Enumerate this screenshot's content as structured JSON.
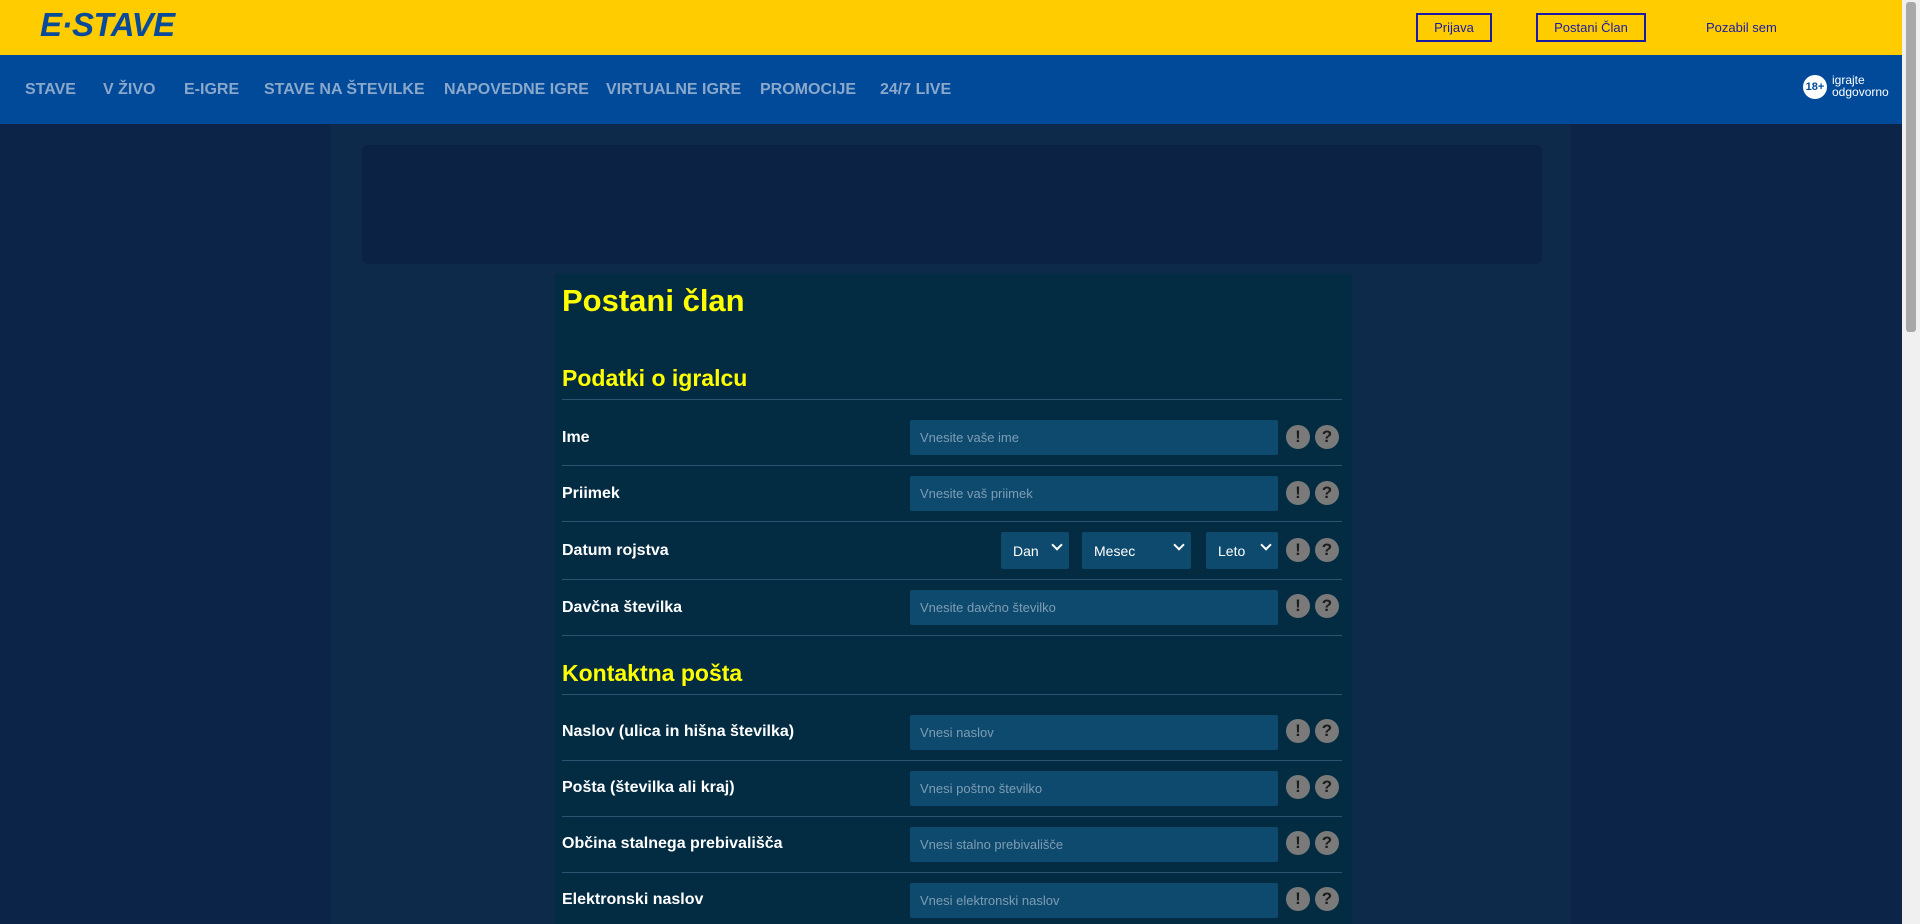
{
  "header": {
    "logo": "E·STAVE",
    "login_label": "Prijava",
    "register_label": "Postani Član",
    "forgot_label": "Pozabil sem"
  },
  "nav": {
    "items": [
      "STAVE",
      "V ŽIVO",
      "E-IGRE",
      "STAVE NA ŠTEVILKE",
      "NAPOVEDNE IGRE",
      "VIRTUALNE IGRE",
      "PROMOCIJE",
      "24/7 LIVE"
    ],
    "age_badge": "18+",
    "responsible_line1": "igrajte",
    "responsible_line2": "odgovorno"
  },
  "page": {
    "title": "Postani član"
  },
  "section_player": {
    "heading": "Podatki o igralcu",
    "first_name_label": "Ime",
    "first_name_placeholder": "Vnesite vaše ime",
    "last_name_label": "Priimek",
    "last_name_placeholder": "Vnesite vaš priimek",
    "birth_label": "Datum rojstva",
    "day_selected": "Dan",
    "month_selected": "Mesec",
    "year_selected": "Leto",
    "tax_label": "Davčna številka",
    "tax_placeholder": "Vnesite davčno številko"
  },
  "section_contact": {
    "heading": "Kontaktna pošta",
    "address_label": "Naslov (ulica in hišna številka)",
    "address_placeholder": "Vnesi naslov",
    "post_label": "Pošta (številka ali kraj)",
    "post_placeholder": "Vnesi poštno številko",
    "municipality_label": "Občina stalnega prebivališča",
    "municipality_placeholder": "Vnesi stalno prebivališče",
    "email_label": "Elektronski naslov",
    "email_placeholder": "Vnesi elektronski naslov"
  },
  "icons": {
    "warning_glyph": "!",
    "help_glyph": "?"
  },
  "colors": {
    "header_yellow": "#ffcc00",
    "nav_blue": "#004a99",
    "heading_yellow": "#ffff00",
    "panel": "#032b42",
    "input": "#0e4a6e"
  }
}
